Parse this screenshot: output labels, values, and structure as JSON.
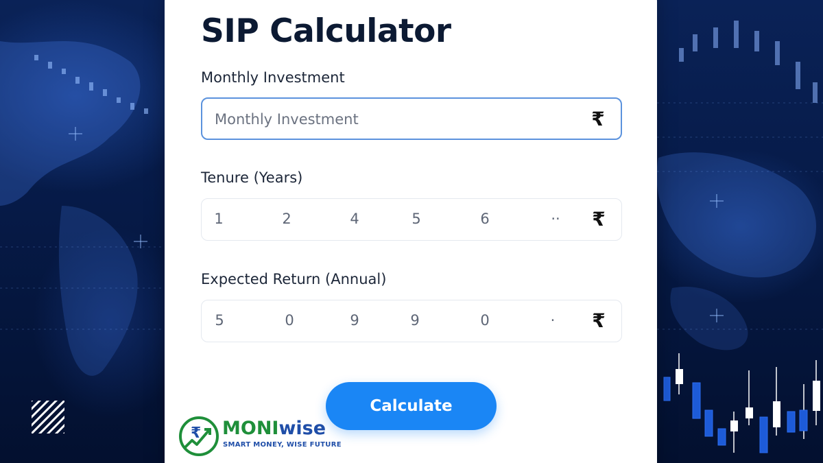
{
  "calculator": {
    "title": "SIP Calculator",
    "monthly_investment": {
      "label": "Monthly Investment",
      "placeholder": "Monthly Investment",
      "value": "",
      "currency_symbol": "₹"
    },
    "tenure": {
      "label": "Tenure (Years)",
      "options": [
        "1",
        "2",
        "4",
        "5",
        "6",
        "··"
      ],
      "currency_symbol": "₹"
    },
    "expected_return": {
      "label": "Expected Return (Annual)",
      "options": [
        "5",
        "0",
        "9",
        "9",
        "0",
        "·"
      ],
      "currency_symbol": "₹"
    },
    "calculate_label": "Calculate"
  },
  "brand": {
    "name_part1": "MONI",
    "name_part2": "wise",
    "tagline": "SMART MONEY, WISE FUTURE",
    "logo_symbol": "₹",
    "colors": {
      "green": "#1f8f3a",
      "blue": "#1f4ea8"
    }
  },
  "colors": {
    "accent": "#1a86f5",
    "background": "#061a47"
  },
  "icons": [
    "rupee-icon",
    "hatch-pattern-icon",
    "moniwise-logo-icon"
  ]
}
